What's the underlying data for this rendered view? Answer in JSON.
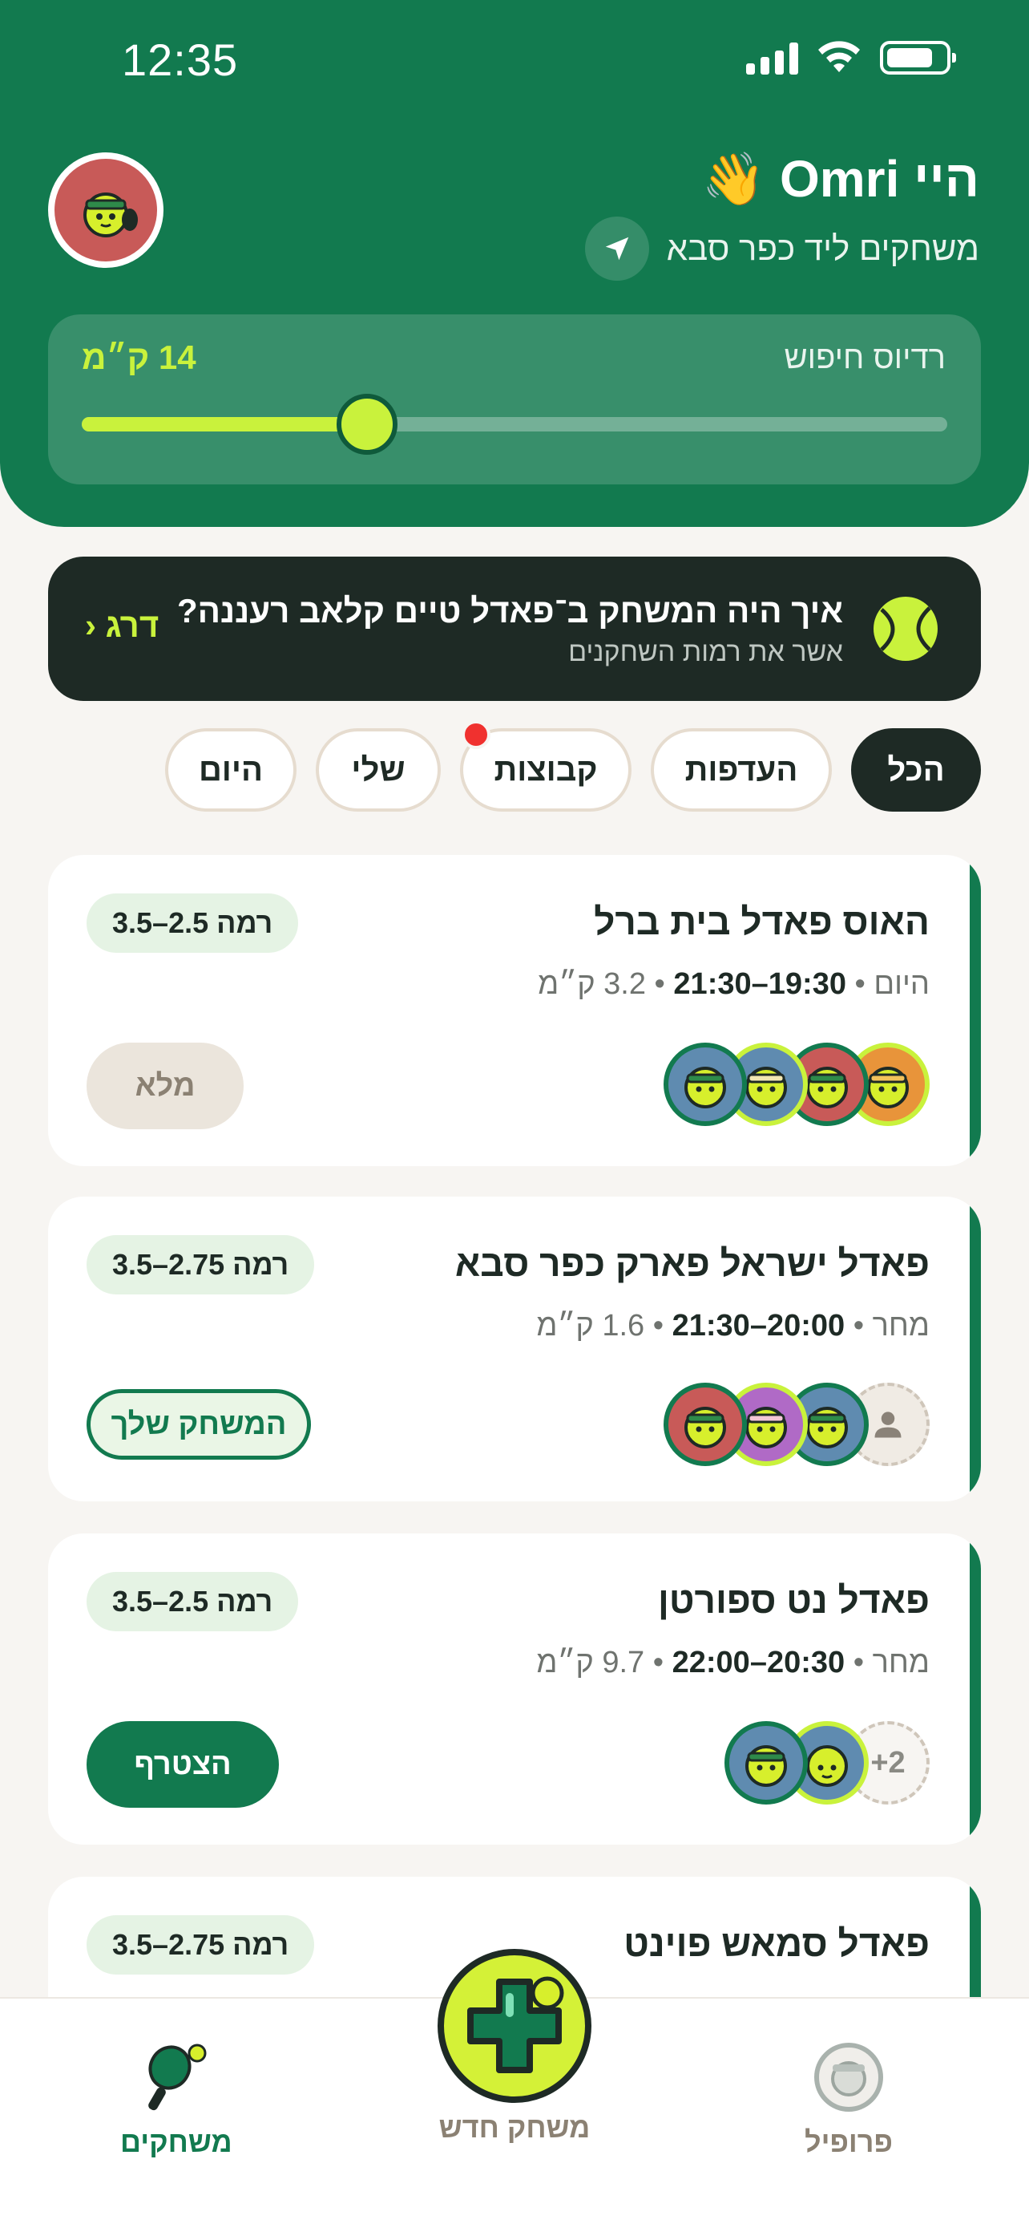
{
  "status_bar": {
    "time": "12:35"
  },
  "header": {
    "greeting": "היי Omri 👋",
    "location_text": "משחקים ליד כפר סבא",
    "radius_label": "רדיוס חיפוש",
    "radius_value": "14 ק״מ",
    "radius_fraction": 0.33
  },
  "banner": {
    "title": "איך היה המשחק ב־פאדל טיים קלאב רעננה?",
    "subtitle": "אשר את רמות השחקנים",
    "cta": "דרג ‹"
  },
  "filters": [
    {
      "label": "הכל",
      "active": true
    },
    {
      "label": "העדפות",
      "active": false
    },
    {
      "label": "קבוצות",
      "active": false,
      "notification": true
    },
    {
      "label": "שלי",
      "active": false
    },
    {
      "label": "היום",
      "active": false
    }
  ],
  "games": [
    {
      "name": "האוס פאדל בית ברל",
      "day": "היום",
      "time": "19:30–21:30",
      "distance": "3.2 ק״מ",
      "level": "רמה 2.5–3.5",
      "action": "מלא",
      "players": [
        "orange",
        "red",
        "blue-highlight",
        "blue"
      ]
    },
    {
      "name": "פאדל ישראל פארק כפר סבא",
      "day": "מחר",
      "time": "20:00–21:30",
      "distance": "1.6 ק״מ",
      "level": "רמה 2.75–3.5",
      "action": "המשחק שלך",
      "players": [
        "empty",
        "blue",
        "purple-highlight",
        "red"
      ]
    },
    {
      "name": "פאדל נט ספורטן",
      "day": "מחר",
      "time": "20:30–22:00",
      "distance": "9.7 ק״מ",
      "level": "רמה 2.5–3.5",
      "action": "הצטרף",
      "players_more": "+2"
    },
    {
      "name": "פאדל סמאש פוינט",
      "level": "רמה 2.75–3.5"
    }
  ],
  "bottom_nav": {
    "games": "משחקים",
    "new_game": "משחק חדש",
    "profile": "פרופיל"
  },
  "colors": {
    "brand_green": "#127a4f",
    "lime": "#c9f23c",
    "dark": "#1e2a25"
  }
}
